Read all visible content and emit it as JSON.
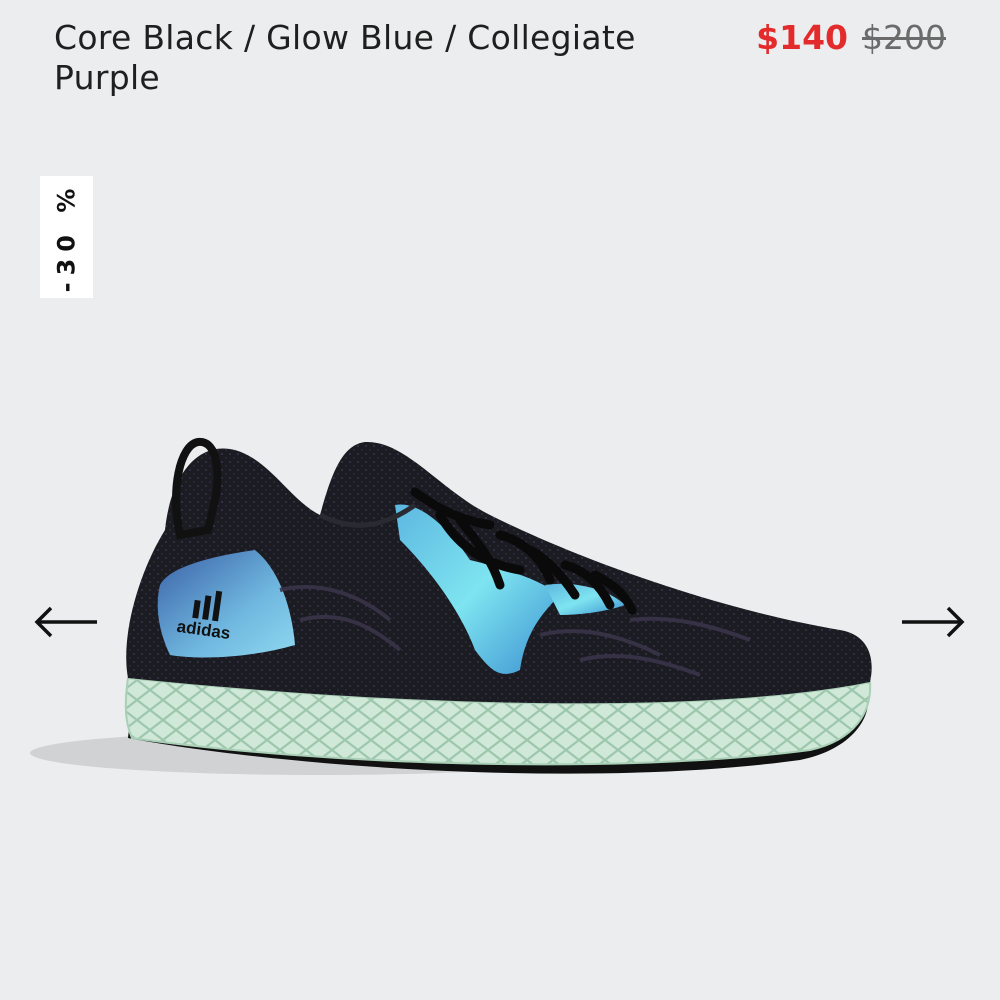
{
  "product": {
    "color_name": "Core Black / Glow Blue / Collegiate Purple",
    "price_sale": "$140",
    "price_original": "$200",
    "discount_badge": "-30 %",
    "brand_logo_text": "adidas"
  },
  "carousel": {
    "prev_icon": "arrow-left-icon",
    "next_icon": "arrow-right-icon"
  },
  "colors": {
    "background": "#ebedee",
    "sale_price": "#e32b2b",
    "original_price": "#6b6b6b",
    "badge_bg": "#ffffff"
  }
}
